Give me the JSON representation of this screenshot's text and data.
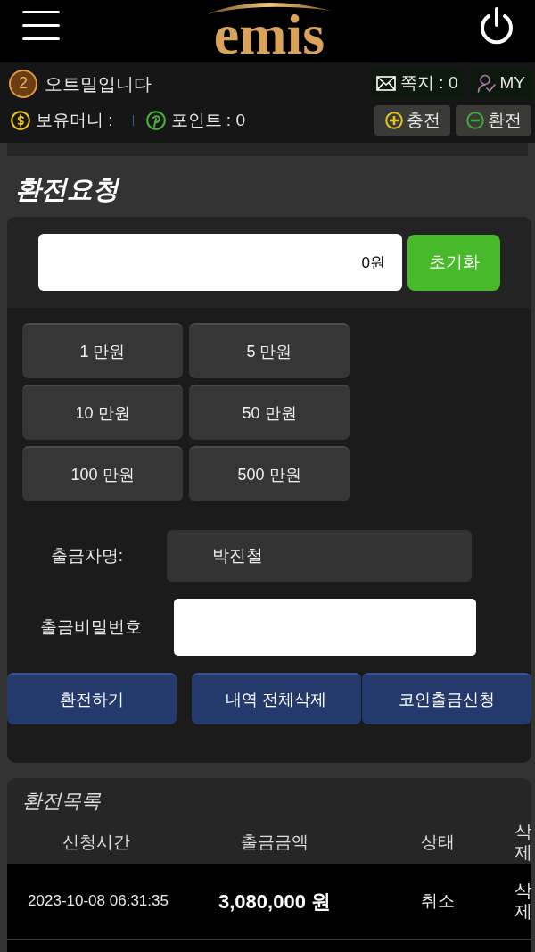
{
  "header": {
    "logo": "emis"
  },
  "user_bar": {
    "level": "2",
    "nickname": "오트밀입니다",
    "links": [
      {
        "kind": "message",
        "label": "쪽지 : 0"
      },
      {
        "kind": "my",
        "label": "MY"
      }
    ],
    "balances": [
      {
        "kind": "money",
        "label": "보유머니 :"
      },
      {
        "kind": "points",
        "label": "포인트 : 0"
      }
    ],
    "actions": [
      {
        "kind": "charge",
        "label": "충전"
      },
      {
        "kind": "exchange",
        "label": "환전"
      }
    ]
  },
  "exchange_request": {
    "title": "환전요청",
    "amount_field": {
      "value": "0원"
    },
    "reset_button": "초기화",
    "amount_buttons": [
      "1 만원",
      "5 만원",
      "10 만원",
      "50 만원",
      "100 만원",
      "500 만원"
    ],
    "fields": [
      {
        "kind": "readonly",
        "label": "출금자명:",
        "value": "박진철"
      },
      {
        "kind": "password",
        "label": "출금비밀번호"
      }
    ],
    "buttons": [
      "환전하기",
      "내역 전체삭제",
      "코인출금신청"
    ]
  },
  "exchange_list": {
    "title": "환전목록",
    "columns": [
      "신청시간",
      "출금금액",
      "상태",
      "삭제"
    ],
    "rows": [
      {
        "time": "2023-10-08 06:31:35",
        "amount": "3,080,000 원",
        "status": "취소",
        "delete": "삭제"
      }
    ]
  }
}
